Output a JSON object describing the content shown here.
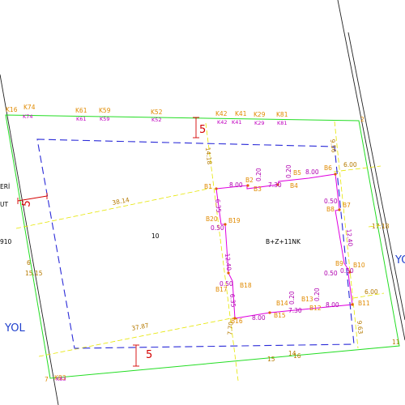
{
  "map": {
    "parcel_no": "10",
    "building_label": "B+Z+11NK",
    "road_labels": [
      "YOL",
      "YOL"
    ],
    "left_edge_labels": [
      "ERİ",
      "UT",
      "910"
    ],
    "setbacks": [
      "5",
      "5",
      "5"
    ],
    "corner_points": [
      "K16",
      "K74",
      "K61",
      "K59",
      "K52",
      "K42",
      "K41",
      "K29",
      "K81",
      "2",
      "K83",
      "7"
    ],
    "corner_points_magenta": [
      "K74",
      "K61",
      "K59",
      "K52",
      "K42",
      "K41",
      "K29",
      "K81"
    ],
    "magenta_misc": [
      "K83"
    ],
    "building_points": [
      "B1",
      "B2",
      "B3",
      "B4",
      "B5",
      "B6",
      "B7",
      "B8",
      "B9",
      "B10",
      "B11",
      "B12",
      "B13",
      "B14",
      "B15",
      "B16",
      "B17",
      "B18",
      "B19",
      "B20"
    ],
    "dimensions_building": [
      "8.00",
      "7.30",
      "8.00",
      "6.00",
      "0.20",
      "0.20",
      "0.50",
      "0.50",
      "12.40",
      "12.40",
      "6.35",
      "6.35",
      "0.50",
      "0.50",
      "0.20",
      "0.20",
      "8.00",
      "7.30",
      "8.00",
      "6.00",
      "0.50"
    ],
    "dimensions_other": [
      "38.14",
      "37.87",
      "14.18",
      "7.70",
      "9.56",
      "9.63",
      "15.15",
      "17.18",
      "11",
      "15",
      "16",
      "14",
      "6"
    ]
  }
}
